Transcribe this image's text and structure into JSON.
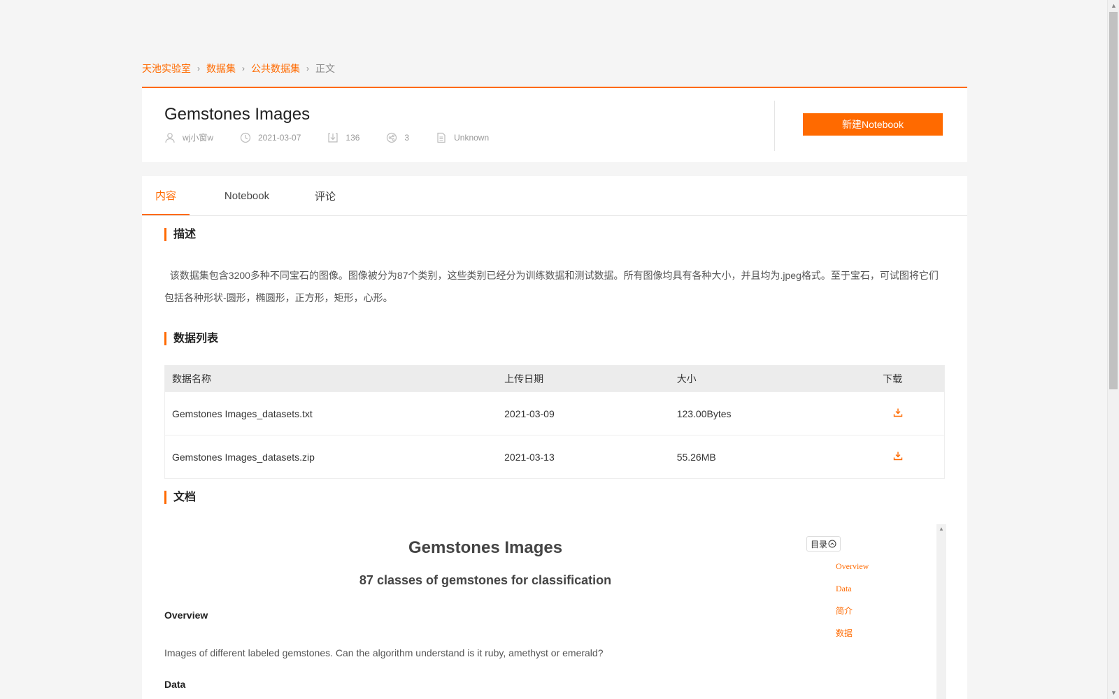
{
  "breadcrumb": {
    "items": [
      "天池实验室",
      "数据集",
      "公共数据集"
    ],
    "current": "正文",
    "separator": "›"
  },
  "dataset": {
    "title": "Gemstones Images",
    "author": "wj小窗w",
    "date": "2021-03-07",
    "downloads": "136",
    "shares": "3",
    "license": "Unknown",
    "new_notebook_label": "新建Notebook"
  },
  "tabs": [
    {
      "label": "内容",
      "active": true
    },
    {
      "label": "Notebook",
      "active": false
    },
    {
      "label": "评论",
      "active": false
    }
  ],
  "sections": {
    "description_title": "描述",
    "description_text": "该数据集包含3200多种不同宝石的图像。图像被分为87个类别，这些类别已经分为训练数据和测试数据。所有图像均具有各种大小，并且均为.jpeg格式。至于宝石，可试图将它们包括各种形状-圆形，椭圆形，正方形，矩形，心形。",
    "data_list_title": "数据列表",
    "docs_title": "文档"
  },
  "table": {
    "headers": [
      "数据名称",
      "上传日期",
      "大小",
      "下载"
    ],
    "rows": [
      {
        "name": "Gemstones Images_datasets.txt",
        "date": "2021-03-09",
        "size": "123.00Bytes"
      },
      {
        "name": "Gemstones Images_datasets.zip",
        "date": "2021-03-13",
        "size": "55.26MB"
      }
    ]
  },
  "doc": {
    "h1": "Gemstones Images",
    "h2": "87 classes of gemstones for classification",
    "overview_heading": "Overview",
    "overview_text": "Images of different labeled gemstones. Can the algorithm understand is it ruby, amethyst or emerald?",
    "data_heading": "Data",
    "toc_label": "目录",
    "toc_items": [
      "Overview",
      "Data",
      "简介",
      "数据"
    ]
  },
  "colors": {
    "accent": "#ff6a00",
    "background": "#f5f5f5",
    "card": "#ffffff"
  }
}
